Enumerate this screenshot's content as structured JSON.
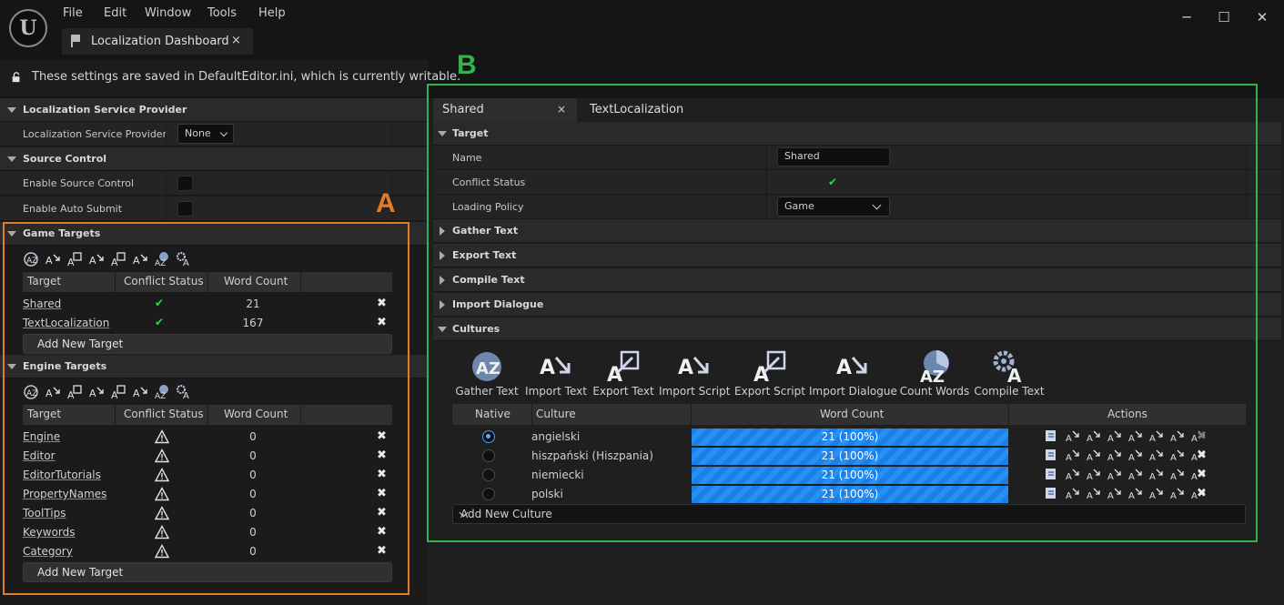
{
  "menu": {
    "file": "File",
    "edit": "Edit",
    "window": "Window",
    "tools": "Tools",
    "help": "Help"
  },
  "main_tab": {
    "label": "Localization Dashboard",
    "close": "×"
  },
  "window_controls": {
    "minimize": "─",
    "maximize": "☐",
    "close": "✕"
  },
  "info_text": "These settings are saved in DefaultEditor.ini, which is currently writable.",
  "annotations": {
    "a": "A",
    "b": "B",
    "a_color": "#e67b25",
    "b_color": "#34b34a"
  },
  "left": {
    "lsp_section": "Localization Service Provider",
    "lsp_label": "Localization Service Provider",
    "lsp_value": "None",
    "source_control_section": "Source Control",
    "enable_source_control": "Enable Source Control",
    "enable_auto_submit": "Enable Auto Submit",
    "game_targets_section": "Game Targets",
    "engine_targets_section": "Engine Targets",
    "col_target": "Target",
    "col_conflict": "Conflict Status",
    "col_word_count": "Word Count",
    "add_new_target": "Add New Target",
    "game_targets": [
      {
        "name": "Shared",
        "status": "ok",
        "count": "21"
      },
      {
        "name": "TextLocalization",
        "status": "ok",
        "count": "167"
      }
    ],
    "engine_targets": [
      {
        "name": "Engine",
        "status": "warning",
        "count": "0"
      },
      {
        "name": "Editor",
        "status": "warning",
        "count": "0"
      },
      {
        "name": "EditorTutorials",
        "status": "warning",
        "count": "0"
      },
      {
        "name": "PropertyNames",
        "status": "warning",
        "count": "0"
      },
      {
        "name": "ToolTips",
        "status": "warning",
        "count": "0"
      },
      {
        "name": "Keywords",
        "status": "warning",
        "count": "0"
      },
      {
        "name": "Category",
        "status": "warning",
        "count": "0"
      }
    ]
  },
  "right": {
    "tabs": [
      {
        "label": "Shared",
        "close": "×"
      },
      {
        "label": "TextLocalization"
      }
    ],
    "target_section": "Target",
    "name_label": "Name",
    "name_value": "Shared",
    "conflict_label": "Conflict Status",
    "loading_label": "Loading Policy",
    "loading_value": "Game",
    "gather_section": "Gather Text",
    "export_section": "Export Text",
    "compile_section": "Compile Text",
    "import_dialogue_section": "Import Dialogue",
    "cultures_section": "Cultures",
    "tools": [
      "Gather Text",
      "Import Text",
      "Export Text",
      "Import Script",
      "Export Script",
      "Import Dialogue",
      "Count Words",
      "Compile Text"
    ],
    "col_native": "Native",
    "col_culture": "Culture",
    "col_word_count": "Word Count",
    "col_actions": "Actions",
    "cultures": [
      {
        "name": "angielski",
        "native": true,
        "count": "21 (100%)"
      },
      {
        "name": "hiszpański (Hiszpania)",
        "native": false,
        "count": "21 (100%)"
      },
      {
        "name": "niemiecki",
        "native": false,
        "count": "21 (100%)"
      },
      {
        "name": "polski",
        "native": false,
        "count": "21 (100%)"
      }
    ],
    "add_new_culture": "Add New Culture",
    "progress_color": "#1a7fe6"
  }
}
